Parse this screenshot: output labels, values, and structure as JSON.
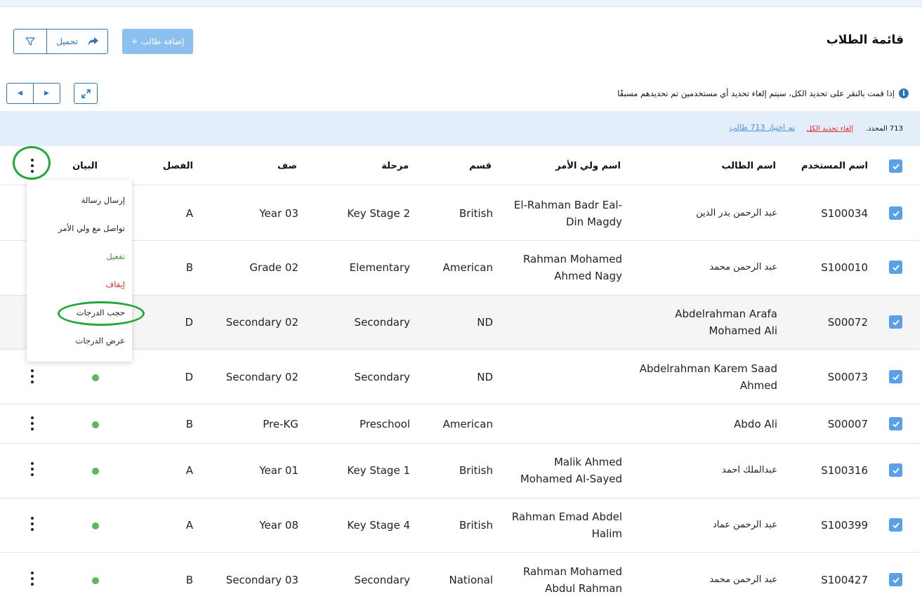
{
  "header": {
    "title": "قائمة الطلاب",
    "export_label": "تحميل",
    "add_student_label": "+ إضافة طالب"
  },
  "info": {
    "message": "إذا قمت بالنقر على تحديد الكل، سيتم إلغاء تحديد أي مستخدمين تم تحديدهم مسبقًا"
  },
  "selection": {
    "selected_count": "713 المحدد.",
    "deselect_all": "إلغاء تحديد الكل",
    "selected_students": "تم اختيار 713 طالب"
  },
  "columns": {
    "username": "اسم المستخدم",
    "student_name": "اسم الطالب",
    "guardian_name": "اسم ولي الأمر",
    "section": "قسم",
    "stage": "مرحلة",
    "grade": "صف",
    "class": "الفصل",
    "status": "البيان"
  },
  "rows": [
    {
      "username": "S100034",
      "student_name": "عبد الرحمن بدر الدين",
      "guardian_line1": "El-Rahman Badr Eal-",
      "guardian_line2": "Din Magdy",
      "section": "British",
      "stage": "Key Stage 2",
      "grade": "Year 03",
      "class": "A",
      "checked": true
    },
    {
      "username": "S100010",
      "student_name": "عبد الرحمن محمد",
      "guardian_line1": "Rahman Mohamed",
      "guardian_line2": "Ahmed Nagy",
      "section": "American",
      "stage": "Elementary",
      "grade": "Grade 02",
      "class": "B",
      "checked": true
    },
    {
      "username": "S00072",
      "student_line1": "Abdelrahman Arafa",
      "student_line2": "Mohamed Ali",
      "section": "ND",
      "stage": "Secondary",
      "grade": "Secondary 02",
      "class": "D",
      "checked": true
    },
    {
      "username": "S00073",
      "student_line1": "Abdelrahman Karem Saad",
      "student_line2": "Ahmed",
      "section": "ND",
      "stage": "Secondary",
      "grade": "Secondary 02",
      "class": "D",
      "checked": true
    },
    {
      "username": "S00007",
      "student_name": "Abdo Ali",
      "section": "American",
      "stage": "Preschool",
      "grade": "Pre-KG",
      "class": "B",
      "checked": true
    },
    {
      "username": "S100316",
      "student_name": "عبدالملك احمد",
      "guardian_line1": "Malik Ahmed",
      "guardian_line2": "Mohamed Al-Sayed",
      "section": "British",
      "stage": "Key Stage 1",
      "grade": "Year 01",
      "class": "A",
      "checked": true
    },
    {
      "username": "S100399",
      "student_name": "عبد الرحمن عماد",
      "guardian_line1": "Rahman Emad Abdel",
      "guardian_line2": "Halim",
      "section": "British",
      "stage": "Key Stage 4",
      "grade": "Year 08",
      "class": "A",
      "checked": true
    },
    {
      "username": "S100427",
      "student_name": "عبد الرحمن محمد",
      "guardian_line1": "Rahman Mohamed",
      "guardian_line2": "Abdul Rahman",
      "section": "National",
      "stage": "Secondary",
      "grade": "Secondary 03",
      "class": "B",
      "checked": true
    }
  ],
  "action_menu": {
    "items": [
      {
        "label": "إرسال رسالة"
      },
      {
        "label": "تواصل مع ولي الأمر"
      },
      {
        "label": "تفعيل"
      },
      {
        "label": "إيقاف"
      },
      {
        "label": "حجب الدرجات"
      },
      {
        "label": "عرض الدرجات"
      }
    ]
  },
  "colors": {
    "primary": "#2e75b6",
    "add_button": "#8cc1ef",
    "checkbox": "#5aa0e6",
    "status_active": "#5cb85c",
    "annotation_ring": "#22a83a",
    "selection_bar": "#e3eefa",
    "deselect_text": "#d32f2f"
  },
  "icons": {
    "filter": "filter-icon",
    "export": "share-arrow-icon",
    "info": "info-icon",
    "prev": "caret-left-icon",
    "next": "caret-right-icon",
    "expand": "expand-icon",
    "check": "check-icon",
    "more": "kebab-icon"
  }
}
